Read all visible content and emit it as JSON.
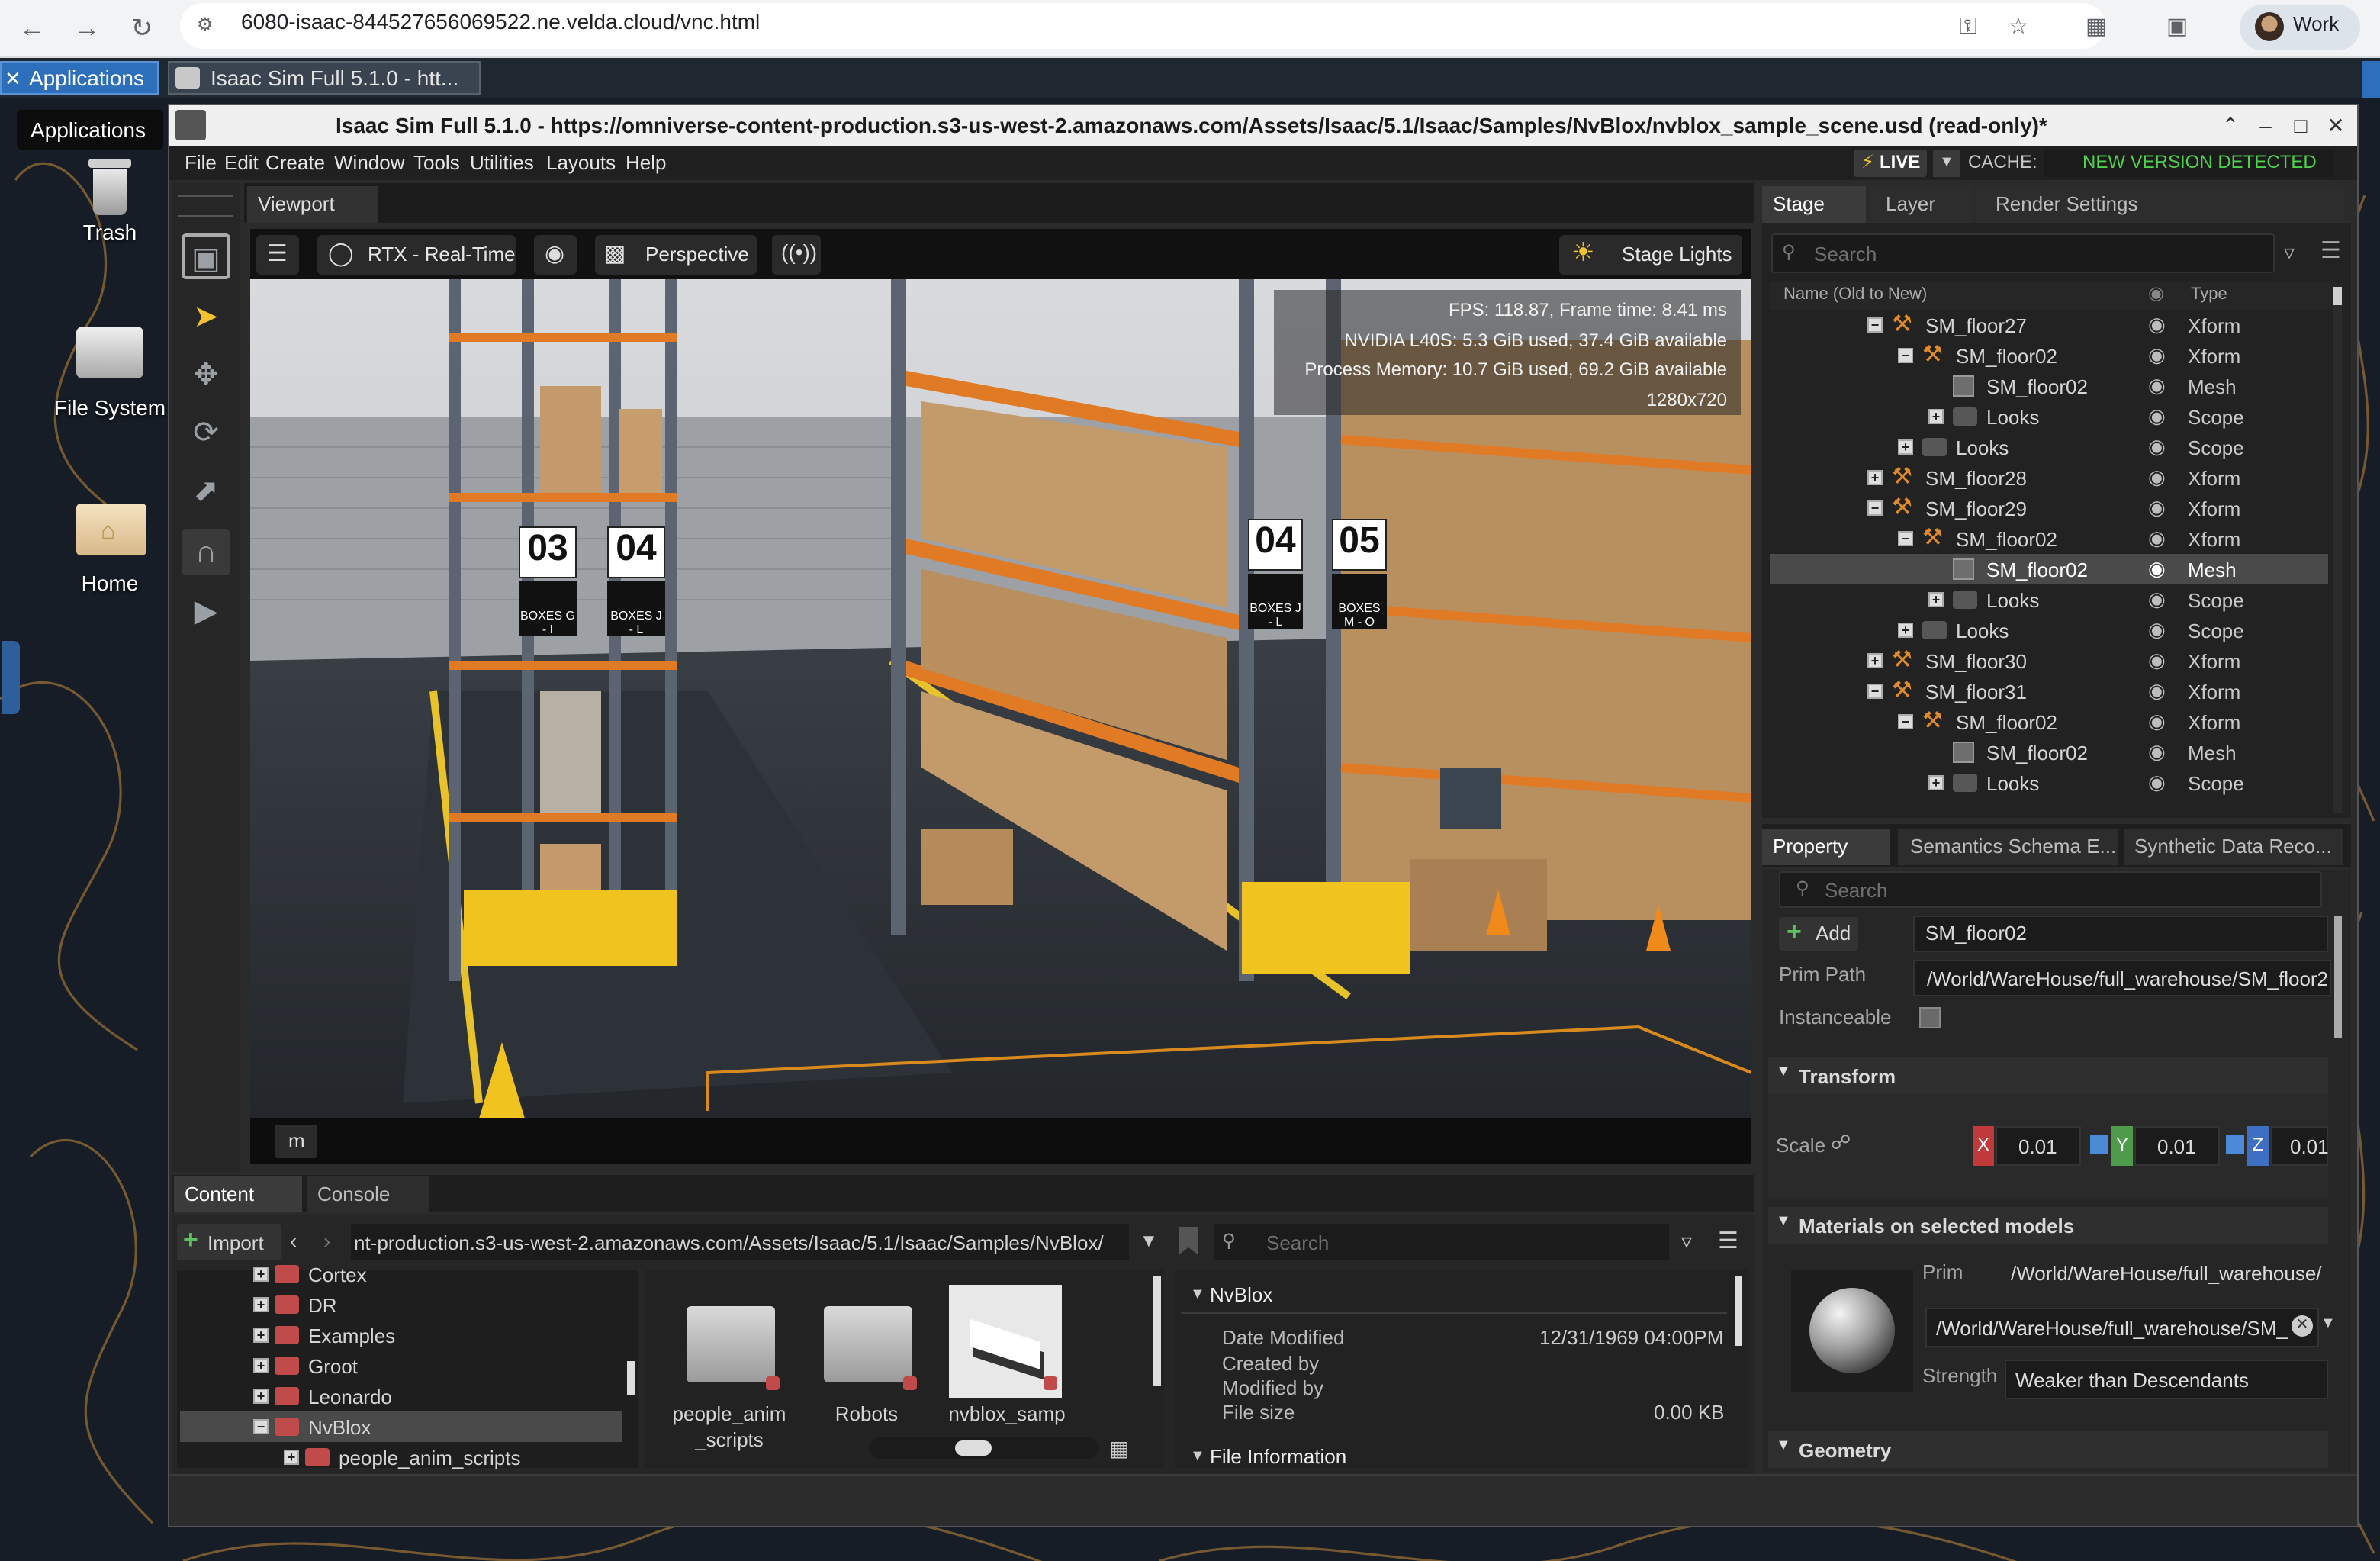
{
  "browser": {
    "url": "6080-isaac-844527656069522.ne.velda.cloud/vnc.html",
    "profile": "Work"
  },
  "desktop": {
    "applications_label": "Applications",
    "taskbar_item": "Isaac Sim Full 5.1.0 - htt...",
    "tooltip": "Applications",
    "icons": [
      {
        "label": "Trash",
        "icon": "trash-icon"
      },
      {
        "label": "File System",
        "icon": "drive-icon"
      },
      {
        "label": "Home",
        "icon": "home-folder-icon"
      }
    ]
  },
  "window": {
    "title": "Isaac Sim Full 5.1.0 - https://omniverse-content-production.s3-us-west-2.amazonaws.com/Assets/Isaac/5.1/Isaac/Samples/NvBlox/nvblox_sample_scene.usd (read-only)*",
    "menus": [
      "File",
      "Edit",
      "Create",
      "Window",
      "Tools",
      "Utilities",
      "Layouts",
      "Help"
    ],
    "live": "LIVE",
    "cache": "CACHE:",
    "new_version": "NEW VERSION DETECTED"
  },
  "viewport": {
    "tab": "Viewport",
    "renderer": "RTX - Real-Time",
    "camera": "Perspective",
    "lights": "Stage Lights",
    "m_button": "m",
    "hud": {
      "fps": "FPS: 118.87, Frame time: 8.41 ms",
      "gpu": "NVIDIA L40S: 5.3 GiB used, 37.4 GiB available",
      "memory": "Process Memory: 10.7 GiB used, 69.2 GiB available",
      "resolution": "1280x720"
    },
    "signs": [
      {
        "number": "03",
        "text": "BOXES G - I"
      },
      {
        "number": "04",
        "text": "BOXES J - L"
      },
      {
        "number": "04",
        "text": "BOXES J - L"
      },
      {
        "number": "05",
        "text": "BOXES M - O"
      }
    ]
  },
  "stage": {
    "tabs": [
      "Stage",
      "Layer",
      "Render Settings"
    ],
    "search_placeholder": "Search",
    "col_name": "Name (Old to New)",
    "col_type": "Type",
    "rows": [
      {
        "name": "SM_floor27",
        "type": "Xform",
        "depth": 0,
        "kind": "xform",
        "exp": "minus"
      },
      {
        "name": "SM_floor02",
        "type": "Xform",
        "depth": 1,
        "kind": "xform",
        "exp": "minus"
      },
      {
        "name": "SM_floor02",
        "type": "Mesh",
        "depth": 2,
        "kind": "mesh",
        "exp": ""
      },
      {
        "name": "Looks",
        "type": "Scope",
        "depth": 2,
        "kind": "folder",
        "exp": "plus"
      },
      {
        "name": "Looks",
        "type": "Scope",
        "depth": 1,
        "kind": "folder",
        "exp": "plus"
      },
      {
        "name": "SM_floor28",
        "type": "Xform",
        "depth": 0,
        "kind": "xform",
        "exp": "plus"
      },
      {
        "name": "SM_floor29",
        "type": "Xform",
        "depth": 0,
        "kind": "xform",
        "exp": "minus"
      },
      {
        "name": "SM_floor02",
        "type": "Xform",
        "depth": 1,
        "kind": "xform",
        "exp": "minus"
      },
      {
        "name": "SM_floor02",
        "type": "Mesh",
        "depth": 2,
        "kind": "mesh",
        "exp": "",
        "selected": true
      },
      {
        "name": "Looks",
        "type": "Scope",
        "depth": 2,
        "kind": "folder",
        "exp": "plus"
      },
      {
        "name": "Looks",
        "type": "Scope",
        "depth": 1,
        "kind": "folder",
        "exp": "plus"
      },
      {
        "name": "SM_floor30",
        "type": "Xform",
        "depth": 0,
        "kind": "xform",
        "exp": "plus"
      },
      {
        "name": "SM_floor31",
        "type": "Xform",
        "depth": 0,
        "kind": "xform",
        "exp": "minus"
      },
      {
        "name": "SM_floor02",
        "type": "Xform",
        "depth": 1,
        "kind": "xform",
        "exp": "minus"
      },
      {
        "name": "SM_floor02",
        "type": "Mesh",
        "depth": 2,
        "kind": "mesh",
        "exp": ""
      },
      {
        "name": "Looks",
        "type": "Scope",
        "depth": 2,
        "kind": "folder",
        "exp": "plus"
      }
    ]
  },
  "property": {
    "tabs": [
      "Property",
      "Semantics Schema E...",
      "Synthetic Data Reco..."
    ],
    "search_placeholder": "Search",
    "add_label": "Add",
    "prim_name": "SM_floor02",
    "prim_path_label": "Prim Path",
    "prim_path": "/World/WareHouse/full_warehouse/SM_floor2",
    "instanceable_label": "Instanceable",
    "transform_label": "Transform",
    "scale_label": "Scale",
    "scale": {
      "x_label": "X",
      "x": "0.01",
      "y_label": "Y",
      "y": "0.01",
      "z_label": "Z",
      "z": "0.01"
    },
    "materials_label": "Materials on selected models",
    "prim_label": "Prim",
    "material_prim": "/World/WareHouse/full_warehouse/",
    "material_path": "/World/WareHouse/full_warehouse/SM_",
    "strength_label": "Strength",
    "strength_value": "Weaker than Descendants",
    "geometry_label": "Geometry"
  },
  "content": {
    "tabs": [
      "Content",
      "Console"
    ],
    "import_label": "Import",
    "path": "nt-production.s3-us-west-2.amazonaws.com/Assets/Isaac/5.1/Isaac/Samples/NvBlox/",
    "search_placeholder": "Search",
    "tree": [
      {
        "label": "Cortex",
        "depth": 0
      },
      {
        "label": "DR",
        "depth": 0
      },
      {
        "label": "Examples",
        "depth": 0
      },
      {
        "label": "Groot",
        "depth": 0
      },
      {
        "label": "Leonardo",
        "depth": 0
      },
      {
        "label": "NvBlox",
        "depth": 0,
        "selected": true,
        "expanded": true
      },
      {
        "label": "people_anim_scripts",
        "depth": 1
      }
    ],
    "files": [
      {
        "line1": "people_anim",
        "line2": "_scripts",
        "kind": "folder"
      },
      {
        "line1": "Robots",
        "line2": "",
        "kind": "folder"
      },
      {
        "line1": "nvblox_samp",
        "line2": "",
        "kind": "thumb"
      }
    ],
    "info": {
      "folder": "NvBlox",
      "date_label": "Date Modified",
      "date_value": "12/31/1969 04:00PM",
      "created_label": "Created by",
      "modified_label": "Modified by",
      "size_label": "File size",
      "size_value": "0.00 KB",
      "file_info_label": "File Information"
    }
  }
}
